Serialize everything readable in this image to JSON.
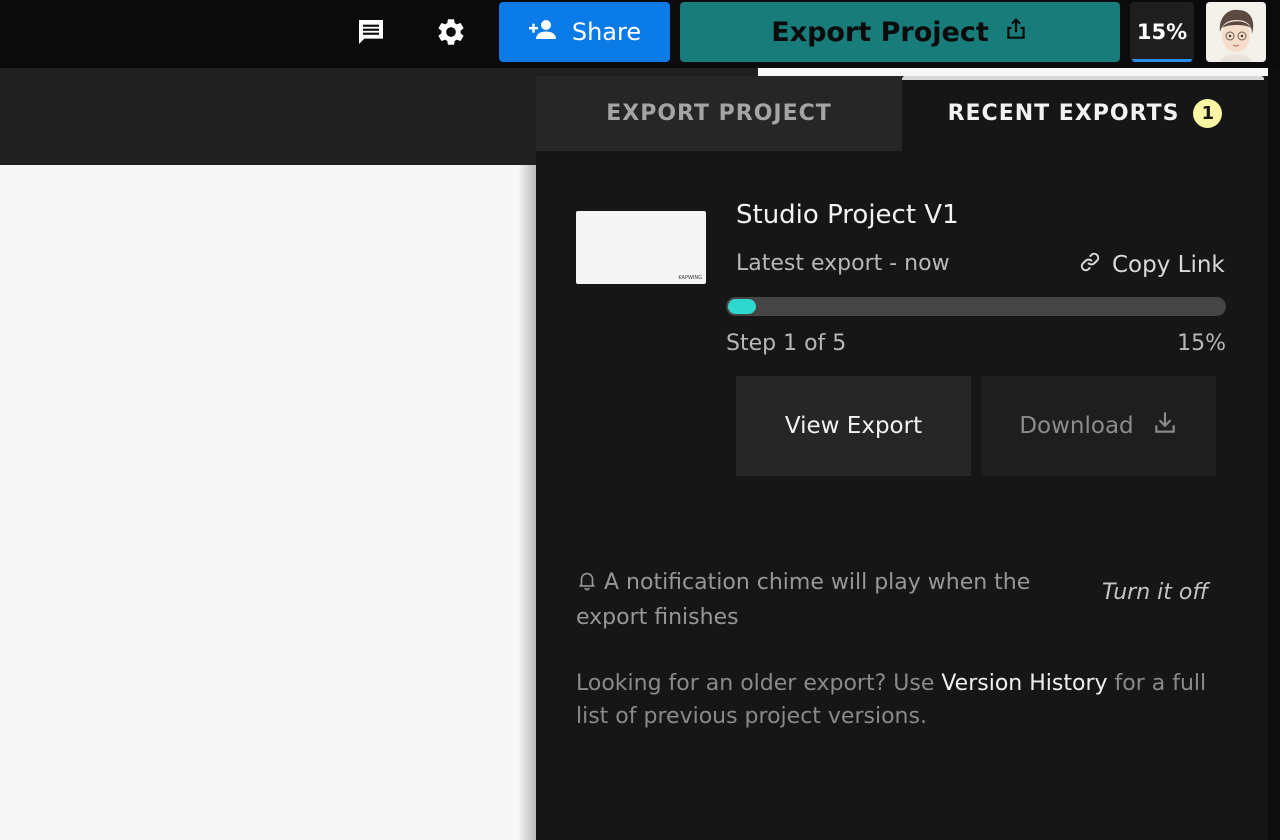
{
  "topbar": {
    "comments_icon": "comment-icon",
    "settings_icon": "gear-icon",
    "share_label": "Share",
    "export_label": "Export Project",
    "progress_label": "15%",
    "progress_fraction": 0.15,
    "accent_share": "#0a7ae6",
    "accent_export": "#177c7a"
  },
  "panel": {
    "tabs": [
      {
        "label": "EXPORT PROJECT",
        "active": false
      },
      {
        "label": "RECENT EXPORTS",
        "active": true,
        "badge": "1"
      }
    ],
    "export": {
      "title": "Studio Project V1",
      "subtitle": "Latest export - now",
      "copy_link": "Copy Link",
      "thumb_logo": "KAPWING",
      "step": "Step 1 of 5",
      "percent": "15%",
      "progress_fraction": 0.15,
      "progress_color": "#2fd8cf",
      "view_label": "View Export",
      "download_label": "Download"
    },
    "notification": {
      "text": "A notification chime will play when the export finishes",
      "action": "Turn it off"
    },
    "older": {
      "prefix": "Looking for an older export? Use ",
      "link": "Version History",
      "suffix": " for a full list of previous project versions."
    }
  }
}
